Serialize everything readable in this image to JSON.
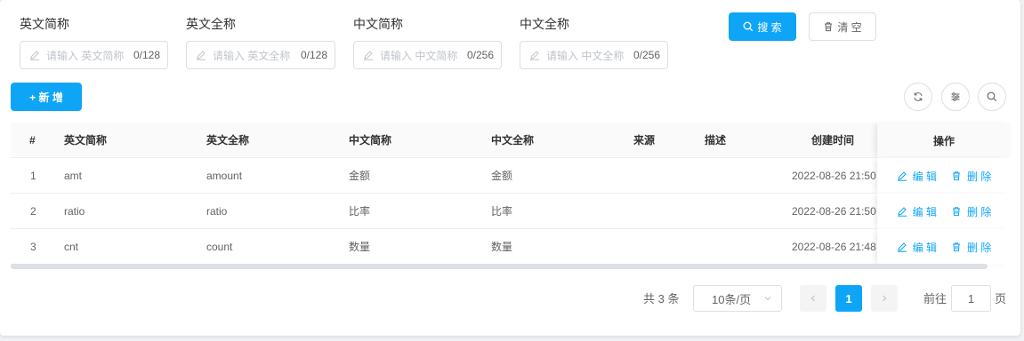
{
  "search": {
    "fields": [
      {
        "label": "英文简称",
        "placeholder": "请输入 英文简称",
        "count": "0/128"
      },
      {
        "label": "英文全称",
        "placeholder": "请输入 英文全称",
        "count": "0/128"
      },
      {
        "label": "中文简称",
        "placeholder": "请输入 中文简称",
        "count": "0/256"
      },
      {
        "label": "中文全称",
        "placeholder": "请输入 中文全称",
        "count": "0/256"
      }
    ],
    "search_label": "搜 索",
    "clear_label": "清 空"
  },
  "toolbar": {
    "add_label": "+ 新 增",
    "icons": [
      "refresh-icon",
      "filter-settings-icon",
      "search-icon"
    ]
  },
  "table": {
    "columns": [
      "#",
      "英文简称",
      "英文全称",
      "中文简称",
      "中文全称",
      "来源",
      "描述",
      "创建时间",
      "操作"
    ],
    "rows": [
      {
        "idx": "1",
        "en_short": "amt",
        "en_full": "amount",
        "cn_short": "金额",
        "cn_full": "金额",
        "source": "",
        "desc": "",
        "created": "2022-08-26 21:50"
      },
      {
        "idx": "2",
        "en_short": "ratio",
        "en_full": "ratio",
        "cn_short": "比率",
        "cn_full": "比率",
        "source": "",
        "desc": "",
        "created": "2022-08-26 21:50"
      },
      {
        "idx": "3",
        "en_short": "cnt",
        "en_full": "count",
        "cn_short": "数量",
        "cn_full": "数量",
        "source": "",
        "desc": "",
        "created": "2022-08-26 21:48"
      }
    ],
    "edit_label": "编 辑",
    "delete_label": "删 除"
  },
  "pagination": {
    "total": "共 3 条",
    "page_size": "10条/页",
    "current_page": "1",
    "goto_prefix": "前往",
    "goto_value": "1",
    "goto_suffix": "页"
  },
  "colors": {
    "primary": "#0ea5f7",
    "border": "#dcdfe6",
    "text": "#606266"
  }
}
